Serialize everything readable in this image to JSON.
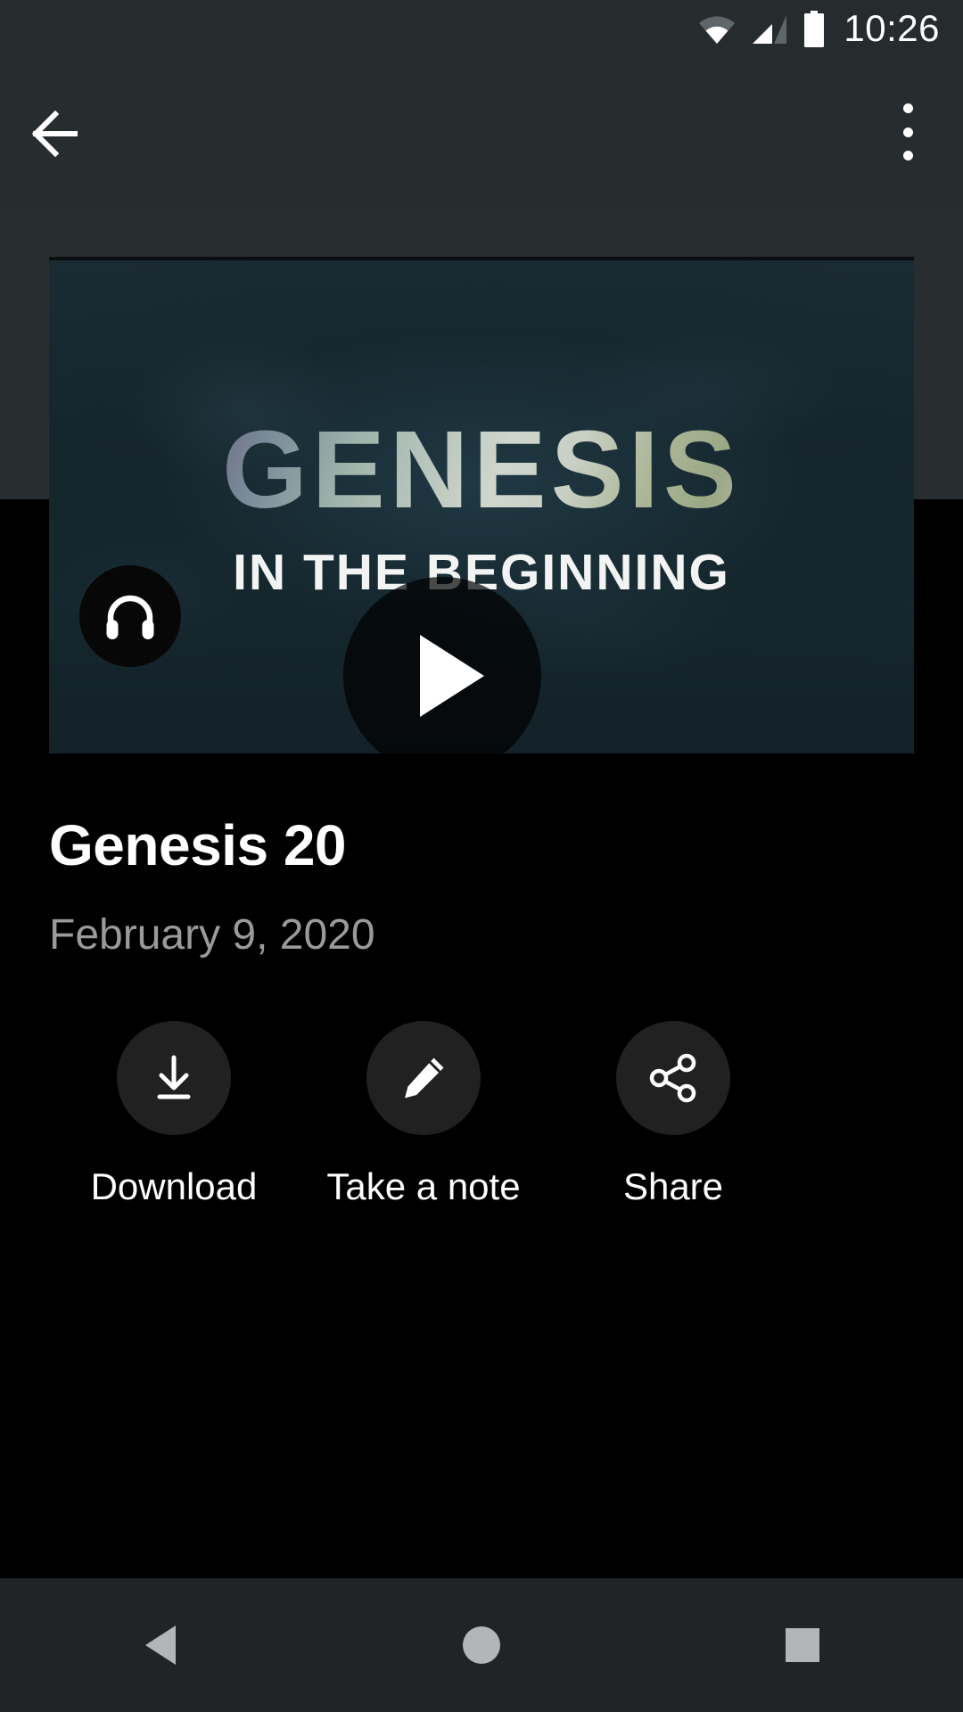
{
  "status_bar": {
    "time": "10:26",
    "icons": [
      "wifi-icon",
      "cellular-signal-icon",
      "battery-icon"
    ]
  },
  "app_bar": {
    "back_icon": "back-arrow-icon",
    "overflow_icon": "more-vertical-icon"
  },
  "video": {
    "artwork_title": "GENESIS",
    "artwork_subtitle": "IN THE BEGINNING",
    "play_icon": "play-icon",
    "audio_icon": "headphones-icon"
  },
  "meta": {
    "title": "Genesis 20",
    "date": "February 9, 2020"
  },
  "actions": [
    {
      "label": "Download",
      "icon": "download-icon"
    },
    {
      "label": "Take a note",
      "icon": "pencil-icon"
    },
    {
      "label": "Share",
      "icon": "share-icon"
    }
  ],
  "nav_bar": {
    "back": "nav-back-icon",
    "home": "nav-home-icon",
    "recents": "nav-recents-icon"
  },
  "colors": {
    "status_bar_bg": "#262b2e",
    "app_bar_bg": "#272c2f",
    "page_bg": "#000000",
    "title_text": "#ffffff",
    "date_text": "#9a9a9a",
    "action_circle_bg": "#212121",
    "nav_bar_bg": "#202427",
    "nav_icon": "#b3b5b6"
  }
}
